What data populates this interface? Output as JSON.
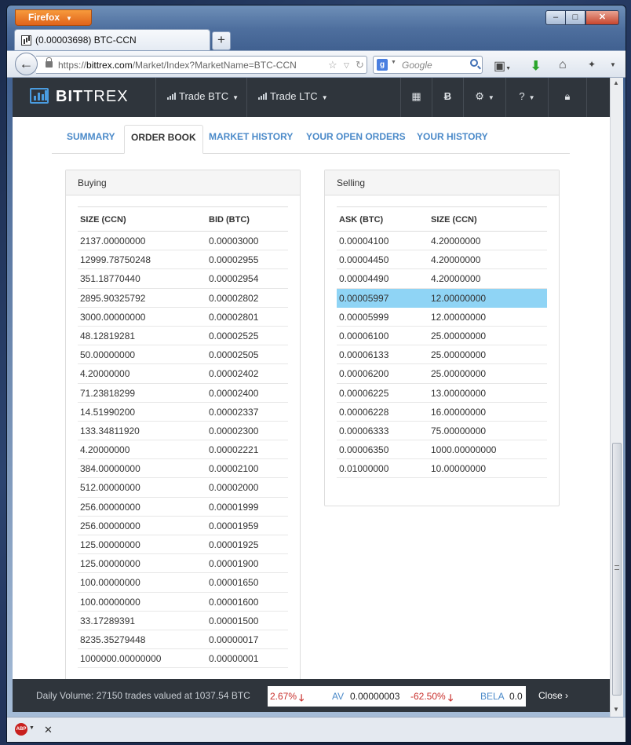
{
  "browser": {
    "app_button": "Firefox",
    "window_controls": {
      "minimize": "–",
      "maximize": "□",
      "close": "✕"
    },
    "tab_title": "(0.00003698) BTC-CCN",
    "new_tab": "+",
    "url_scheme": "https://",
    "url_domain": "bittrex.com",
    "url_path": "/Market/Index?MarketName=BTC-CCN",
    "search_placeholder": "Google"
  },
  "site": {
    "brand_bold": "BIT",
    "brand_rest": "TREX",
    "nav": [
      "Trade BTC",
      "Trade LTC"
    ]
  },
  "tabs": [
    "SUMMARY",
    "ORDER BOOK",
    "MARKET HISTORY",
    "YOUR OPEN ORDERS",
    "YOUR HISTORY"
  ],
  "active_tab": "ORDER BOOK",
  "buying": {
    "title": "Buying",
    "col_size": "SIZE (CCN)",
    "col_bid": "BID (BTC)",
    "rows": [
      [
        "2137.00000000",
        "0.00003000"
      ],
      [
        "12999.78750248",
        "0.00002955"
      ],
      [
        "351.18770440",
        "0.00002954"
      ],
      [
        "2895.90325792",
        "0.00002802"
      ],
      [
        "3000.00000000",
        "0.00002801"
      ],
      [
        "48.12819281",
        "0.00002525"
      ],
      [
        "50.00000000",
        "0.00002505"
      ],
      [
        "4.20000000",
        "0.00002402"
      ],
      [
        "71.23818299",
        "0.00002400"
      ],
      [
        "14.51990200",
        "0.00002337"
      ],
      [
        "133.34811920",
        "0.00002300"
      ],
      [
        "4.20000000",
        "0.00002221"
      ],
      [
        "384.00000000",
        "0.00002100"
      ],
      [
        "512.00000000",
        "0.00002000"
      ],
      [
        "256.00000000",
        "0.00001999"
      ],
      [
        "256.00000000",
        "0.00001959"
      ],
      [
        "125.00000000",
        "0.00001925"
      ],
      [
        "125.00000000",
        "0.00001900"
      ],
      [
        "100.00000000",
        "0.00001650"
      ],
      [
        "100.00000000",
        "0.00001600"
      ],
      [
        "33.17289391",
        "0.00001500"
      ],
      [
        "8235.35279448",
        "0.00000017"
      ],
      [
        "1000000.00000000",
        "0.00000001"
      ]
    ]
  },
  "selling": {
    "title": "Selling",
    "col_ask": "ASK (BTC)",
    "col_size": "SIZE (CCN)",
    "highlighted_row": 3,
    "rows": [
      [
        "0.00004100",
        "4.20000000"
      ],
      [
        "0.00004450",
        "4.20000000"
      ],
      [
        "0.00004490",
        "4.20000000"
      ],
      [
        "0.00005997",
        "12.00000000"
      ],
      [
        "0.00005999",
        "12.00000000"
      ],
      [
        "0.00006100",
        "25.00000000"
      ],
      [
        "0.00006133",
        "25.00000000"
      ],
      [
        "0.00006200",
        "25.00000000"
      ],
      [
        "0.00006225",
        "13.00000000"
      ],
      [
        "0.00006228",
        "16.00000000"
      ],
      [
        "0.00006333",
        "75.00000000"
      ],
      [
        "0.00006350",
        "1000.00000000"
      ],
      [
        "0.01000000",
        "10.00000000"
      ]
    ]
  },
  "footer": {
    "daily_volume": "Daily Volume: 27150 trades valued at 1037.54 BTC",
    "ticker": {
      "prev_change": "2.67%",
      "market": "AV",
      "price": "0.00000003",
      "change": "-62.50%",
      "next_market": "BELA",
      "next_price": "0.0"
    },
    "close": "Close"
  },
  "colors": {
    "accent": "#4b8ac9",
    "nav_bg": "#2f353c",
    "highlight": "#8fd4f5",
    "down": "#c9302c"
  }
}
